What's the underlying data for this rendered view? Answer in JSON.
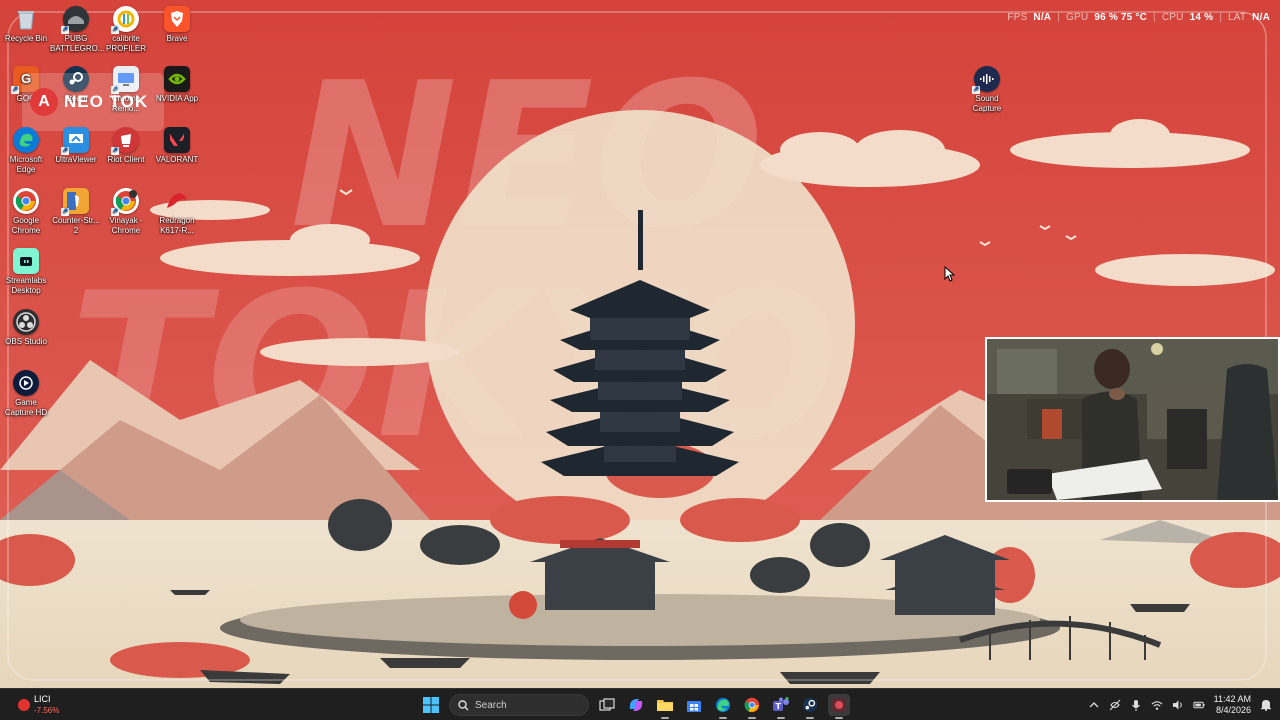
{
  "perf_overlay": {
    "fps_label": "FPS",
    "fps_value": "N/A",
    "gpu_label": "GPU",
    "gpu_value": "96 % 75 °C",
    "cpu_label": "CPU",
    "cpu_value": "14 %",
    "lat_label": "LAT",
    "lat_value": "N/A",
    "separator": "|"
  },
  "desktop_icons": [
    {
      "label": "Recycle Bin",
      "icon": "recycle-bin-icon"
    },
    {
      "label": "PUBG BATTLEGRO...",
      "icon": "pubg-icon"
    },
    {
      "label": "calibrite PROFILER",
      "icon": "calibrite-icon"
    },
    {
      "label": "Brave",
      "icon": "brave-icon"
    },
    {
      "label": "GOG",
      "icon": "gog-icon"
    },
    {
      "label": "Steam",
      "icon": "steam-icon"
    },
    {
      "label": "Chrome Remo...",
      "icon": "chrome-remote-icon"
    },
    {
      "label": "NVIDIA App",
      "icon": "nvidia-icon"
    },
    {
      "label": "Microsoft Edge",
      "icon": "edge-icon"
    },
    {
      "label": "UltraViewer",
      "icon": "ultraviewer-icon"
    },
    {
      "label": "Riot Client",
      "icon": "riot-icon"
    },
    {
      "label": "VALORANT",
      "icon": "valorant-icon"
    },
    {
      "label": "Google Chrome",
      "icon": "chrome-icon"
    },
    {
      "label": "Counter-Str... 2",
      "icon": "cs2-icon"
    },
    {
      "label": "Vinayak - Chrome",
      "icon": "chrome-profile-icon"
    },
    {
      "label": "Redragon K617-R...",
      "icon": "redragon-icon"
    },
    {
      "label": "Streamlabs Desktop",
      "icon": "streamlabs-icon"
    },
    {
      "label": "OBS Studio",
      "icon": "obs-icon"
    },
    {
      "label": "Game Capture HD",
      "icon": "game-capture-icon"
    },
    {
      "label": "Sound Capture",
      "icon": "sound-capture-icon"
    }
  ],
  "brand_logo": {
    "text": "NEO TOK",
    "mark": "A"
  },
  "wallpaper": {
    "big_text_line1": "NEO",
    "big_text_line2": "TOKYO"
  },
  "taskbar": {
    "weather": {
      "ticker": "LICI",
      "change": "-7.56%",
      "color": "#e0322f"
    },
    "search_placeholder": "Search",
    "pinned_apps": [
      {
        "name": "start-button",
        "icon": "windows-icon"
      },
      {
        "name": "search",
        "icon": "search-icon"
      },
      {
        "name": "task-view",
        "icon": "task-view-icon"
      },
      {
        "name": "copilot",
        "icon": "copilot-icon"
      },
      {
        "name": "file-explorer",
        "icon": "folder-icon"
      },
      {
        "name": "microsoft-store",
        "icon": "store-icon"
      },
      {
        "name": "edge",
        "icon": "edge-icon"
      },
      {
        "name": "chrome",
        "icon": "chrome-icon"
      },
      {
        "name": "teams",
        "icon": "teams-icon"
      },
      {
        "name": "steam",
        "icon": "steam-icon"
      },
      {
        "name": "recorder",
        "icon": "recorder-icon"
      }
    ],
    "clock_time": "11:42 AM",
    "clock_date": "8/4/2026"
  },
  "colors": {
    "wallpaper_red": "#d8463f",
    "taskbar_bg": "#1f1f1f",
    "accent": "#0078d4"
  }
}
